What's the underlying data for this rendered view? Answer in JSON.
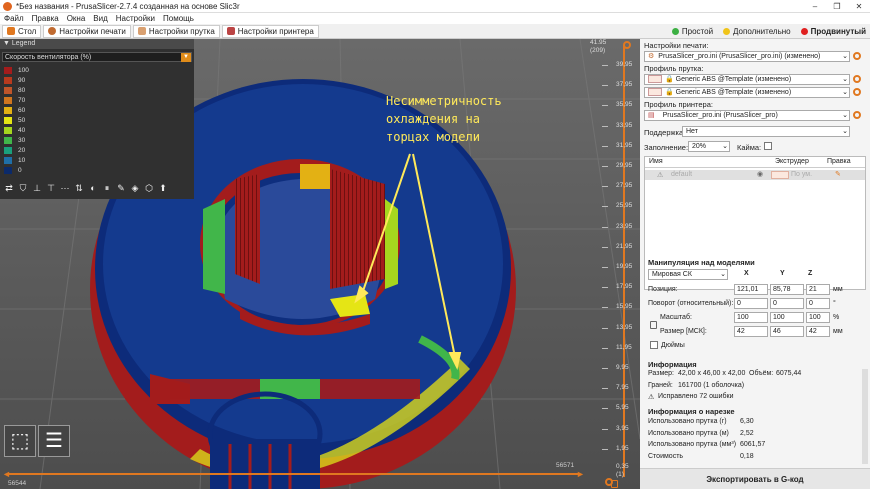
{
  "window": {
    "title": "*Без названия - PrusaSlicer-2.7.4 созданная на основе Slic3r",
    "minimize": "–",
    "maximize": "❐",
    "close": "✕"
  },
  "menu": [
    "Файл",
    "Правка",
    "Окна",
    "Вид",
    "Настройки",
    "Помощь"
  ],
  "tabs": [
    "Стол",
    "Настройки печати",
    "Настройки прутка",
    "Настройки принтера"
  ],
  "modes": [
    {
      "label": "Простой",
      "color": "#3cb043"
    },
    {
      "label": "Дополнительно",
      "color": "#f0c419"
    },
    {
      "label": "Продвинутый",
      "color": "#e02020"
    }
  ],
  "legend": {
    "title": "Legend",
    "selected": "Скорость вентилятора (%)",
    "items": [
      {
        "label": "100",
        "color": "#a31c1c"
      },
      {
        "label": "90",
        "color": "#b83a1e"
      },
      {
        "label": "80",
        "color": "#c0552a"
      },
      {
        "label": "70",
        "color": "#d1761f"
      },
      {
        "label": "60",
        "color": "#e3b114"
      },
      {
        "label": "50",
        "color": "#e5e515"
      },
      {
        "label": "40",
        "color": "#a6d61e"
      },
      {
        "label": "30",
        "color": "#41b64a"
      },
      {
        "label": "20",
        "color": "#1aa07c"
      },
      {
        "label": "10",
        "color": "#1f6fa8"
      },
      {
        "label": "0",
        "color": "#0b2a6a"
      }
    ]
  },
  "annotation": "Несимметричность\nохлаждения на\nторцах модели",
  "hslider": {
    "left": "56544",
    "right": "56571"
  },
  "vslider": {
    "top": "41.95",
    "top2": "(209)",
    "ticks": [
      "39,95",
      "37,95",
      "35,95",
      "33,95",
      "31,95",
      "29,95",
      "27,95",
      "25,95",
      "23,95",
      "21,95",
      "19,95",
      "17,95",
      "15,95",
      "13,95",
      "11,95",
      "9,95",
      "7,95",
      "5,95",
      "3,95",
      "1,95"
    ],
    "bottom": "0,35",
    "bottom2": "(1)"
  },
  "panel": {
    "print_label": "Настройки печати:",
    "print_value": "PrusaSlicer_pro.ini (PrusaSlicer_pro.ini) (изменено)",
    "filament_label": "Профиль прутка:",
    "filament_values": [
      "Generic ABS @Template (изменено)",
      "Generic ABS @Template (изменено)"
    ],
    "printer_label": "Профиль принтера:",
    "printer_value": "PrusaSlicer_pro.ini (PrusaSlicer_pro)",
    "supports_label": "Поддержка:",
    "supports_value": "Нет",
    "infill_label": "Заполнение:",
    "infill_value": "20%",
    "brim_label": "Кайма:",
    "cols": {
      "name": "Имя",
      "extruder": "Экструдер",
      "edit": "Правка"
    },
    "object_name": "default",
    "object_extruder": "По ум.",
    "manip_title": "Манипуляция над моделями",
    "coord_system": "Мировая СК",
    "axes": [
      "X",
      "Y",
      "Z"
    ],
    "position_label": "Позиция:",
    "position": [
      "121,01",
      "85,78",
      "21"
    ],
    "position_unit": "мм",
    "rotation_label": "Поворот (относительный):",
    "rotation": [
      "0",
      "0",
      "0"
    ],
    "rotation_unit": "°",
    "scale_label": "Масштаб:",
    "scale": [
      "100",
      "100",
      "100"
    ],
    "scale_unit": "%",
    "size_label": "Размер [МСК]:",
    "size": [
      "42",
      "46",
      "42"
    ],
    "size_unit": "мм",
    "inches_label": "Дюймы",
    "info_title": "Информация",
    "info_size_label": "Размер:",
    "info_size_value": "42,00 x 46,00 x 42,00",
    "info_volume_label": "Объём:",
    "info_volume_value": "6075,44",
    "info_facets_label": "Граней:",
    "info_facets_value": "161700 (1 оболочка)",
    "info_fixed": "Исправлено 72 ошибки",
    "slice_title": "Информация о нарезке",
    "slice_rows": [
      {
        "label": "Использовано прутка (г)",
        "value": "6,30"
      },
      {
        "label": "Использовано прутка (м)",
        "value": "2,52"
      },
      {
        "label": "Использовано прутка (мм³)",
        "value": "6061,57"
      },
      {
        "label": "Стоимость",
        "value": "0,18"
      }
    ],
    "export_button": "Экспортировать в G-код"
  }
}
